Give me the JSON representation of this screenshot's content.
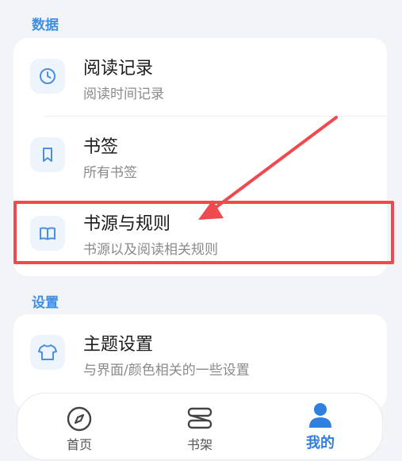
{
  "sections": {
    "data_title": "数据",
    "settings_title": "设置"
  },
  "data_items": [
    {
      "title": "阅读记录",
      "subtitle": "阅读时间记录",
      "icon": "clock-icon"
    },
    {
      "title": "书签",
      "subtitle": "所有书签",
      "icon": "bookmark-icon"
    },
    {
      "title": "书源与规则",
      "subtitle": "书源以及阅读相关规则",
      "icon": "book-open-icon"
    }
  ],
  "settings_items": [
    {
      "title": "主题设置",
      "subtitle": "与界面/颜色相关的一些设置",
      "icon": "tshirt-icon"
    }
  ],
  "bottom_nav": {
    "items": [
      {
        "label": "首页",
        "icon": "compass-icon",
        "active": false
      },
      {
        "label": "书架",
        "icon": "bookshelf-icon",
        "active": false
      },
      {
        "label": "我的",
        "icon": "person-icon",
        "active": true
      }
    ]
  },
  "colors": {
    "accent": "#3d8fe6",
    "highlight": "#ef4a4f",
    "background": "#f2f4f7"
  }
}
